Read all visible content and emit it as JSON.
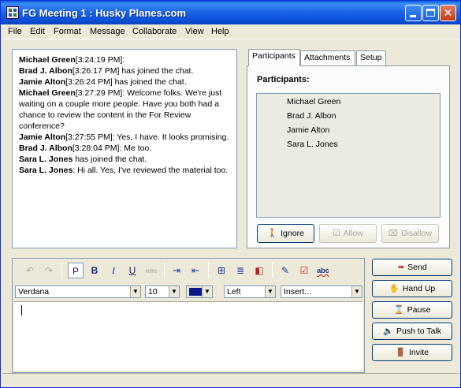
{
  "window": {
    "title": "FG Meeting 1 : Husky Planes.com"
  },
  "menu": [
    "File",
    "Edit",
    "Format",
    "Message",
    "Collaborate",
    "View",
    "Help"
  ],
  "transcript": [
    {
      "sender": "Michael Green",
      "text": "[3:24:19 PM]:"
    },
    {
      "sender": "Brad J. Albon",
      "text": "[3:26:17 PM] has joined the chat."
    },
    {
      "sender": "Jamie Alton",
      "text": "[3:26:24 PM] has joined the chat."
    },
    {
      "sender": "Michael Green",
      "text": "[3:27:29 PM]: Welcome folks. We're just waiting on a couple more people. Have you both had a chance to review the content in the For Review conference?"
    },
    {
      "sender": "Jamie Alton",
      "text": "[3:27:55 PM]: Yes, I have. It looks promising."
    },
    {
      "sender": "Brad J. Albon",
      "text": "[3:28:04 PM]: Me too."
    },
    {
      "sender": "Sara L. Jones",
      "text": " has joined the chat."
    },
    {
      "sender": "Sara L. Jones",
      "text": ": Hi all. Yes, I've reviewed the material too."
    }
  ],
  "tabs": [
    "Participants",
    "Attachments",
    "Setup"
  ],
  "participants": {
    "heading": "Participants:",
    "names": [
      "Michael Green",
      "Brad J. Albon",
      "Jamie Alton",
      "Sara L. Jones"
    ],
    "buttons": {
      "ignore": "Ignore",
      "allow": "Allow",
      "disallow": "Disallow"
    }
  },
  "format": {
    "font": "Verdana",
    "size": "10",
    "align": "Left",
    "insert": "Insert...",
    "tools": {
      "paragraph": "P",
      "bold": "B",
      "italic": "I",
      "underline": "U",
      "spell": "abc"
    }
  },
  "actions": {
    "send": "Send",
    "hand_up": "Hand Up",
    "pause": "Pause",
    "push_to_talk": "Push to Talk",
    "invite": "Invite"
  },
  "colors": {
    "titlebar": "#0a4fd6",
    "text_color": "#0a1a8a"
  }
}
